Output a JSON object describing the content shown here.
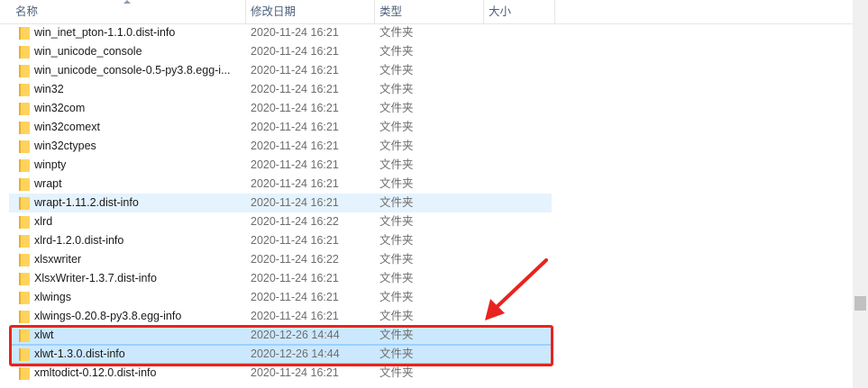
{
  "columns": {
    "name": "名称",
    "date": "修改日期",
    "type": "类型",
    "size": "大小"
  },
  "files": [
    {
      "name": "win_inet_pton-1.1.0.dist-info",
      "date": "2020-11-24 16:21",
      "type": "文件夹"
    },
    {
      "name": "win_unicode_console",
      "date": "2020-11-24 16:21",
      "type": "文件夹"
    },
    {
      "name": "win_unicode_console-0.5-py3.8.egg-i...",
      "date": "2020-11-24 16:21",
      "type": "文件夹"
    },
    {
      "name": "win32",
      "date": "2020-11-24 16:21",
      "type": "文件夹"
    },
    {
      "name": "win32com",
      "date": "2020-11-24 16:21",
      "type": "文件夹"
    },
    {
      "name": "win32comext",
      "date": "2020-11-24 16:21",
      "type": "文件夹"
    },
    {
      "name": "win32ctypes",
      "date": "2020-11-24 16:21",
      "type": "文件夹"
    },
    {
      "name": "winpty",
      "date": "2020-11-24 16:21",
      "type": "文件夹"
    },
    {
      "name": "wrapt",
      "date": "2020-11-24 16:21",
      "type": "文件夹"
    },
    {
      "name": "wrapt-1.11.2.dist-info",
      "date": "2020-11-24 16:21",
      "type": "文件夹",
      "state": "hover"
    },
    {
      "name": "xlrd",
      "date": "2020-11-24 16:22",
      "type": "文件夹"
    },
    {
      "name": "xlrd-1.2.0.dist-info",
      "date": "2020-11-24 16:21",
      "type": "文件夹"
    },
    {
      "name": "xlsxwriter",
      "date": "2020-11-24 16:22",
      "type": "文件夹"
    },
    {
      "name": "XlsxWriter-1.3.7.dist-info",
      "date": "2020-11-24 16:21",
      "type": "文件夹"
    },
    {
      "name": "xlwings",
      "date": "2020-11-24 16:21",
      "type": "文件夹"
    },
    {
      "name": "xlwings-0.20.8-py3.8.egg-info",
      "date": "2020-11-24 16:21",
      "type": "文件夹"
    },
    {
      "name": "xlwt",
      "date": "2020-12-26 14:44",
      "type": "文件夹",
      "state": "selected"
    },
    {
      "name": "xlwt-1.3.0.dist-info",
      "date": "2020-12-26 14:44",
      "type": "文件夹",
      "state": "selected"
    },
    {
      "name": "xmltodict-0.12.0.dist-info",
      "date": "2020-11-24 16:21",
      "type": "文件夹"
    }
  ],
  "colors": {
    "folder": "#ffd35b",
    "selection": "#cce8ff",
    "hover": "#e5f3ff",
    "annotation": "#e8231f"
  },
  "icons": {
    "folder": "folder-icon",
    "annotation": "red-arrow-annotation"
  }
}
